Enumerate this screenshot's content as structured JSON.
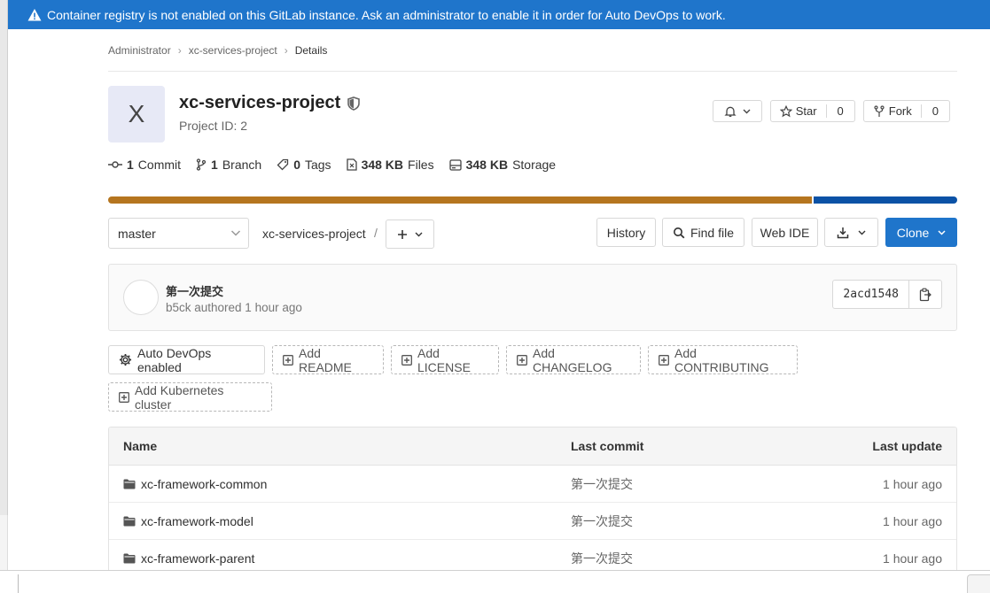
{
  "banner": {
    "message": "Container registry is not enabled on this GitLab instance. Ask an administrator to enable it in order for Auto DevOps to work.",
    "icon": "warning-icon"
  },
  "breadcrumb": {
    "items": [
      "Administrator",
      "xc-services-project",
      "Details"
    ]
  },
  "project": {
    "avatar_letter": "X",
    "name": "xc-services-project",
    "id_label": "Project ID: 2"
  },
  "actions": {
    "star_label": "Star",
    "star_count": "0",
    "fork_label": "Fork",
    "fork_count": "0"
  },
  "stats": {
    "commits_count": "1",
    "commits_label": "Commit",
    "branches_count": "1",
    "branches_label": "Branch",
    "tags_count": "0",
    "tags_label": "Tags",
    "files_size": "348 KB",
    "files_label": "Files",
    "storage_size": "348 KB",
    "storage_label": "Storage"
  },
  "language_bar": {
    "colors": [
      "#b5751f",
      "#0b52a6"
    ]
  },
  "toolbar": {
    "branch": "master",
    "path": "xc-services-project",
    "path_sep": "/",
    "history": "History",
    "find_file": "Find file",
    "web_ide": "Web IDE",
    "clone": "Clone"
  },
  "last_commit": {
    "title": "第一次提交",
    "meta": "b5ck authored 1 hour ago",
    "sha": "2acd1548"
  },
  "quick_actions": {
    "auto_devops": "Auto DevOps enabled",
    "readme": "Add README",
    "license": "Add LICENSE",
    "changelog": "Add CHANGELOG",
    "contributing": "Add CONTRIBUTING",
    "kubernetes": "Add Kubernetes cluster"
  },
  "tree": {
    "headers": {
      "name": "Name",
      "last_commit": "Last commit",
      "last_update": "Last update"
    },
    "rows": [
      {
        "name": "xc-framework-common",
        "commit": "第一次提交",
        "updated": "1 hour ago"
      },
      {
        "name": "xc-framework-model",
        "commit": "第一次提交",
        "updated": "1 hour ago"
      },
      {
        "name": "xc-framework-parent",
        "commit": "第一次提交",
        "updated": "1 hour ago"
      }
    ]
  },
  "colors": {
    "primary_blue": "#1f75cb",
    "avatar_bg": "#e7e9f6"
  }
}
